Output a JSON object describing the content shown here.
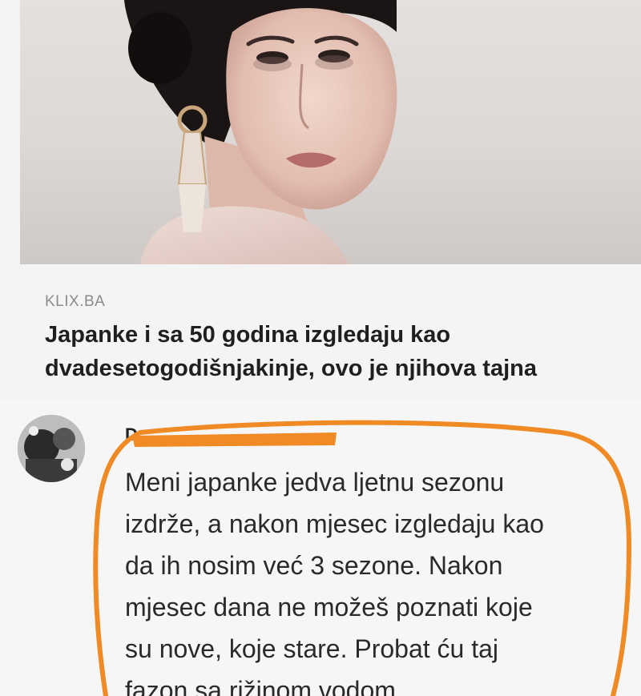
{
  "link_preview": {
    "image_alt": "woman-portrait-photo",
    "source": "KLIX.BA",
    "headline": "Japanke i sa 50 godina izgledaju kao dvadesetogodišnjakinje, ovo je njihova tajna"
  },
  "comment": {
    "author_initial": "D",
    "text": "Meni japanke jedva ljetnu sezonu\nizdrže, a nakon mjesec izgledaju kao\nda ih nosim već 3 sezone. Nakon\nmjesec dana ne možeš poznati koje\nsu nove, koje stare. Probat ću taj\nfazon sa rižinom vodom."
  },
  "colors": {
    "highlight": "#f08a24",
    "headline": "#1f1f1f",
    "source": "#8b8b8b"
  }
}
